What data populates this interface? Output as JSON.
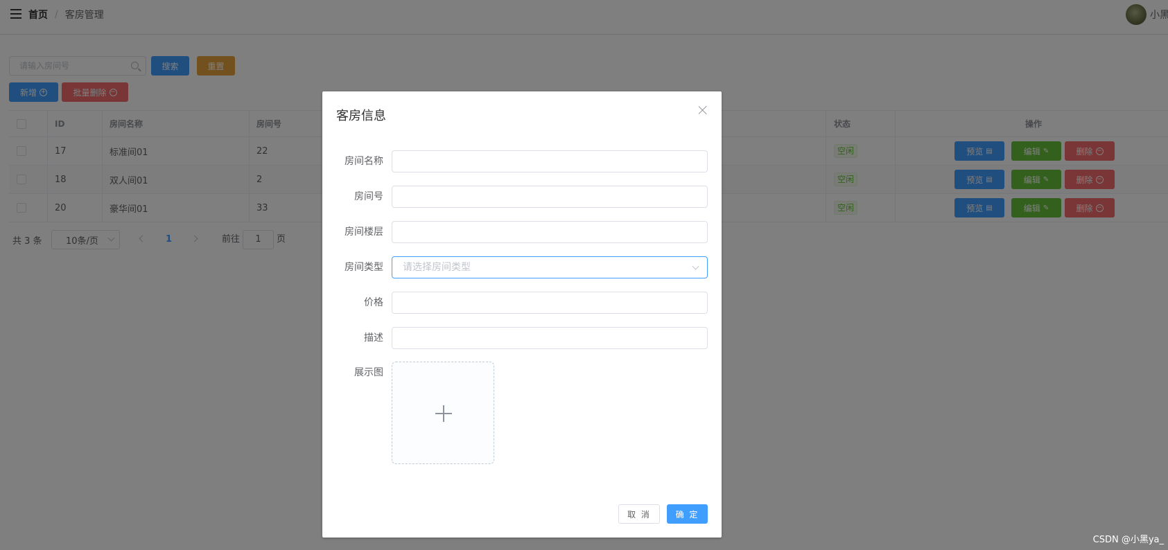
{
  "header": {
    "breadcrumb_home": "首页",
    "breadcrumb_sep": "/",
    "breadcrumb_current": "客房管理",
    "user_name": "小黑"
  },
  "toolbar": {
    "search_placeholder": "请输入房间号",
    "search_label": "搜索",
    "reset_label": "重置",
    "add_label": "新增",
    "batch_delete_label": "批量删除"
  },
  "table": {
    "columns": {
      "id": "ID",
      "name": "房间名称",
      "number": "房间号",
      "status": "状态",
      "actions": "操作"
    },
    "rows": [
      {
        "id": "17",
        "name": "标准间01",
        "number": "22",
        "status": "空闲"
      },
      {
        "id": "18",
        "name": "双人间01",
        "number": "2",
        "status": "空闲"
      },
      {
        "id": "20",
        "name": "豪华间01",
        "number": "33",
        "status": "空闲"
      }
    ],
    "action_preview": "预览",
    "action_edit": "编辑",
    "action_delete": "删除"
  },
  "pager": {
    "total": "共 3 条",
    "page_size": "10条/页",
    "current_page": "1",
    "goto_label": "前往",
    "goto_value": "1",
    "goto_suffix": "页"
  },
  "dialog": {
    "title": "客房信息",
    "fields": {
      "name": "房间名称",
      "number": "房间号",
      "floor": "房间楼层",
      "type": "房间类型",
      "type_placeholder": "请选择房间类型",
      "price": "价格",
      "desc": "描述",
      "image": "展示图"
    },
    "cancel_label": "取 消",
    "ok_label": "确 定"
  },
  "watermark": "CSDN @小黑ya_",
  "colors": {
    "primary": "#409eff",
    "success": "#67c23a",
    "warning": "#e6a23c",
    "danger": "#f56c6c"
  }
}
